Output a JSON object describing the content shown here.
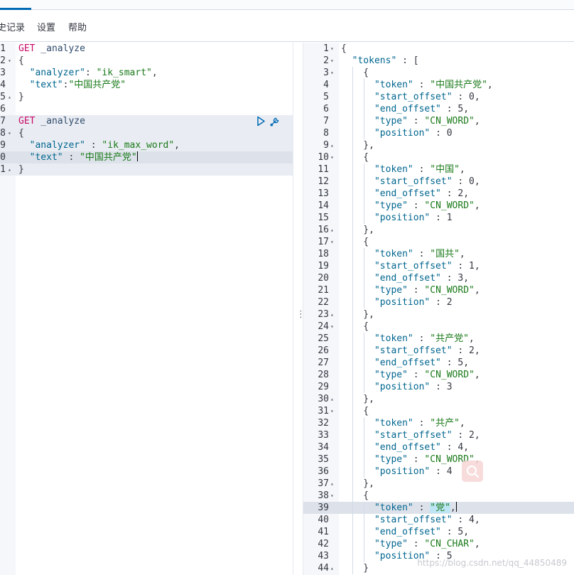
{
  "menu": {
    "history": "史记录",
    "settings": "设置",
    "help": "帮助"
  },
  "request_editor": {
    "lines": [
      {
        "n": "1",
        "fold": "",
        "parts": [
          [
            "method",
            "GET"
          ],
          [
            "url",
            " _analyze"
          ]
        ]
      },
      {
        "n": "2",
        "fold": "▾",
        "parts": [
          [
            "punc",
            "{"
          ]
        ]
      },
      {
        "n": "3",
        "fold": "",
        "parts": [
          [
            "punc",
            "  "
          ],
          [
            "key",
            "\"analyzer\""
          ],
          [
            "punc",
            ": "
          ],
          [
            "str",
            "\"ik_smart\""
          ],
          [
            "punc",
            ","
          ]
        ]
      },
      {
        "n": "4",
        "fold": "",
        "parts": [
          [
            "punc",
            "  "
          ],
          [
            "key",
            "\"text\""
          ],
          [
            "punc",
            ":"
          ],
          [
            "str",
            "\"中国共产党\""
          ]
        ]
      },
      {
        "n": "5",
        "fold": "▴",
        "parts": [
          [
            "punc",
            "}"
          ]
        ]
      },
      {
        "n": "6",
        "fold": "",
        "parts": []
      },
      {
        "n": "7",
        "fold": "",
        "parts": [
          [
            "method",
            "GET"
          ],
          [
            "url",
            " _analyze"
          ]
        ]
      },
      {
        "n": "8",
        "fold": "▾",
        "parts": [
          [
            "punc",
            "{"
          ]
        ]
      },
      {
        "n": "9",
        "fold": "",
        "parts": [
          [
            "punc",
            "  "
          ],
          [
            "key",
            "\"analyzer\""
          ],
          [
            "punc",
            " : "
          ],
          [
            "str",
            "\"ik_max_word\""
          ],
          [
            "punc",
            ","
          ]
        ]
      },
      {
        "n": "0",
        "fold": "",
        "parts": [
          [
            "punc",
            "  "
          ],
          [
            "key",
            "\"text\""
          ],
          [
            "punc",
            " : "
          ],
          [
            "str",
            "\"中国共产党\""
          ]
        ]
      },
      {
        "n": "1",
        "fold": "▴",
        "parts": [
          [
            "punc",
            "}"
          ]
        ]
      }
    ]
  },
  "response_viewer": {
    "lines": [
      {
        "n": "1",
        "fold": "▾",
        "parts": [
          [
            "punc",
            "{"
          ]
        ]
      },
      {
        "n": "2",
        "fold": "▾",
        "parts": [
          [
            "punc",
            "  "
          ],
          [
            "key",
            "\"tokens\""
          ],
          [
            "punc",
            " : ["
          ]
        ]
      },
      {
        "n": "3",
        "fold": "▾",
        "parts": [
          [
            "punc",
            "    {"
          ]
        ]
      },
      {
        "n": "4",
        "fold": "",
        "parts": [
          [
            "punc",
            "      "
          ],
          [
            "key",
            "\"token\""
          ],
          [
            "punc",
            " : "
          ],
          [
            "str",
            "\"中国共产党\""
          ],
          [
            "punc",
            ","
          ]
        ]
      },
      {
        "n": "5",
        "fold": "",
        "parts": [
          [
            "punc",
            "      "
          ],
          [
            "key",
            "\"start_offset\""
          ],
          [
            "punc",
            " : "
          ],
          [
            "num",
            "0"
          ],
          [
            "punc",
            ","
          ]
        ]
      },
      {
        "n": "6",
        "fold": "",
        "parts": [
          [
            "punc",
            "      "
          ],
          [
            "key",
            "\"end_offset\""
          ],
          [
            "punc",
            " : "
          ],
          [
            "num",
            "5"
          ],
          [
            "punc",
            ","
          ]
        ]
      },
      {
        "n": "7",
        "fold": "",
        "parts": [
          [
            "punc",
            "      "
          ],
          [
            "key",
            "\"type\""
          ],
          [
            "punc",
            " : "
          ],
          [
            "str",
            "\"CN_WORD\""
          ],
          [
            "punc",
            ","
          ]
        ]
      },
      {
        "n": "8",
        "fold": "",
        "parts": [
          [
            "punc",
            "      "
          ],
          [
            "key",
            "\"position\""
          ],
          [
            "punc",
            " : "
          ],
          [
            "num",
            "0"
          ]
        ]
      },
      {
        "n": "9",
        "fold": "▴",
        "parts": [
          [
            "punc",
            "    },"
          ]
        ]
      },
      {
        "n": "10",
        "fold": "▾",
        "parts": [
          [
            "punc",
            "    {"
          ]
        ]
      },
      {
        "n": "11",
        "fold": "",
        "parts": [
          [
            "punc",
            "      "
          ],
          [
            "key",
            "\"token\""
          ],
          [
            "punc",
            " : "
          ],
          [
            "str",
            "\"中国\""
          ],
          [
            "punc",
            ","
          ]
        ]
      },
      {
        "n": "12",
        "fold": "",
        "parts": [
          [
            "punc",
            "      "
          ],
          [
            "key",
            "\"start_offset\""
          ],
          [
            "punc",
            " : "
          ],
          [
            "num",
            "0"
          ],
          [
            "punc",
            ","
          ]
        ]
      },
      {
        "n": "13",
        "fold": "",
        "parts": [
          [
            "punc",
            "      "
          ],
          [
            "key",
            "\"end_offset\""
          ],
          [
            "punc",
            " : "
          ],
          [
            "num",
            "2"
          ],
          [
            "punc",
            ","
          ]
        ]
      },
      {
        "n": "14",
        "fold": "",
        "parts": [
          [
            "punc",
            "      "
          ],
          [
            "key",
            "\"type\""
          ],
          [
            "punc",
            " : "
          ],
          [
            "str",
            "\"CN_WORD\""
          ],
          [
            "punc",
            ","
          ]
        ]
      },
      {
        "n": "15",
        "fold": "",
        "parts": [
          [
            "punc",
            "      "
          ],
          [
            "key",
            "\"position\""
          ],
          [
            "punc",
            " : "
          ],
          [
            "num",
            "1"
          ]
        ]
      },
      {
        "n": "16",
        "fold": "▴",
        "parts": [
          [
            "punc",
            "    },"
          ]
        ]
      },
      {
        "n": "17",
        "fold": "▾",
        "parts": [
          [
            "punc",
            "    {"
          ]
        ]
      },
      {
        "n": "18",
        "fold": "",
        "parts": [
          [
            "punc",
            "      "
          ],
          [
            "key",
            "\"token\""
          ],
          [
            "punc",
            " : "
          ],
          [
            "str",
            "\"国共\""
          ],
          [
            "punc",
            ","
          ]
        ]
      },
      {
        "n": "19",
        "fold": "",
        "parts": [
          [
            "punc",
            "      "
          ],
          [
            "key",
            "\"start_offset\""
          ],
          [
            "punc",
            " : "
          ],
          [
            "num",
            "1"
          ],
          [
            "punc",
            ","
          ]
        ]
      },
      {
        "n": "20",
        "fold": "",
        "parts": [
          [
            "punc",
            "      "
          ],
          [
            "key",
            "\"end_offset\""
          ],
          [
            "punc",
            " : "
          ],
          [
            "num",
            "3"
          ],
          [
            "punc",
            ","
          ]
        ]
      },
      {
        "n": "21",
        "fold": "",
        "parts": [
          [
            "punc",
            "      "
          ],
          [
            "key",
            "\"type\""
          ],
          [
            "punc",
            " : "
          ],
          [
            "str",
            "\"CN_WORD\""
          ],
          [
            "punc",
            ","
          ]
        ]
      },
      {
        "n": "22",
        "fold": "",
        "parts": [
          [
            "punc",
            "      "
          ],
          [
            "key",
            "\"position\""
          ],
          [
            "punc",
            " : "
          ],
          [
            "num",
            "2"
          ]
        ]
      },
      {
        "n": "23",
        "fold": "▴",
        "parts": [
          [
            "punc",
            "    },"
          ]
        ]
      },
      {
        "n": "24",
        "fold": "▾",
        "parts": [
          [
            "punc",
            "    {"
          ]
        ]
      },
      {
        "n": "25",
        "fold": "",
        "parts": [
          [
            "punc",
            "      "
          ],
          [
            "key",
            "\"token\""
          ],
          [
            "punc",
            " : "
          ],
          [
            "str",
            "\"共产党\""
          ],
          [
            "punc",
            ","
          ]
        ]
      },
      {
        "n": "26",
        "fold": "",
        "parts": [
          [
            "punc",
            "      "
          ],
          [
            "key",
            "\"start_offset\""
          ],
          [
            "punc",
            " : "
          ],
          [
            "num",
            "2"
          ],
          [
            "punc",
            ","
          ]
        ]
      },
      {
        "n": "27",
        "fold": "",
        "parts": [
          [
            "punc",
            "      "
          ],
          [
            "key",
            "\"end_offset\""
          ],
          [
            "punc",
            " : "
          ],
          [
            "num",
            "5"
          ],
          [
            "punc",
            ","
          ]
        ]
      },
      {
        "n": "28",
        "fold": "",
        "parts": [
          [
            "punc",
            "      "
          ],
          [
            "key",
            "\"type\""
          ],
          [
            "punc",
            " : "
          ],
          [
            "str",
            "\"CN_WORD\""
          ],
          [
            "punc",
            ","
          ]
        ]
      },
      {
        "n": "29",
        "fold": "",
        "parts": [
          [
            "punc",
            "      "
          ],
          [
            "key",
            "\"position\""
          ],
          [
            "punc",
            " : "
          ],
          [
            "num",
            "3"
          ]
        ]
      },
      {
        "n": "30",
        "fold": "▴",
        "parts": [
          [
            "punc",
            "    },"
          ]
        ]
      },
      {
        "n": "31",
        "fold": "▾",
        "parts": [
          [
            "punc",
            "    {"
          ]
        ]
      },
      {
        "n": "32",
        "fold": "",
        "parts": [
          [
            "punc",
            "      "
          ],
          [
            "key",
            "\"token\""
          ],
          [
            "punc",
            " : "
          ],
          [
            "str",
            "\"共产\""
          ],
          [
            "punc",
            ","
          ]
        ]
      },
      {
        "n": "33",
        "fold": "",
        "parts": [
          [
            "punc",
            "      "
          ],
          [
            "key",
            "\"start_offset\""
          ],
          [
            "punc",
            " : "
          ],
          [
            "num",
            "2"
          ],
          [
            "punc",
            ","
          ]
        ]
      },
      {
        "n": "34",
        "fold": "",
        "parts": [
          [
            "punc",
            "      "
          ],
          [
            "key",
            "\"end_offset\""
          ],
          [
            "punc",
            " : "
          ],
          [
            "num",
            "4"
          ],
          [
            "punc",
            ","
          ]
        ]
      },
      {
        "n": "35",
        "fold": "",
        "parts": [
          [
            "punc",
            "      "
          ],
          [
            "key",
            "\"type\""
          ],
          [
            "punc",
            " : "
          ],
          [
            "str",
            "\"CN_WORD\""
          ],
          [
            "punc",
            ","
          ]
        ]
      },
      {
        "n": "36",
        "fold": "",
        "parts": [
          [
            "punc",
            "      "
          ],
          [
            "key",
            "\"position\""
          ],
          [
            "punc",
            " : "
          ],
          [
            "num",
            "4"
          ]
        ]
      },
      {
        "n": "37",
        "fold": "▴",
        "parts": [
          [
            "punc",
            "    },"
          ]
        ]
      },
      {
        "n": "38",
        "fold": "▾",
        "parts": [
          [
            "punc",
            "    {"
          ]
        ]
      },
      {
        "n": "39",
        "fold": "",
        "parts": [
          [
            "punc",
            "      "
          ],
          [
            "key",
            "\"token\""
          ],
          [
            "punc",
            " : "
          ],
          [
            "hl",
            "\"党\""
          ],
          [
            "punc",
            ","
          ]
        ]
      },
      {
        "n": "40",
        "fold": "",
        "parts": [
          [
            "punc",
            "      "
          ],
          [
            "key",
            "\"start_offset\""
          ],
          [
            "punc",
            " : "
          ],
          [
            "num",
            "4"
          ],
          [
            "punc",
            ","
          ]
        ]
      },
      {
        "n": "41",
        "fold": "",
        "parts": [
          [
            "punc",
            "      "
          ],
          [
            "key",
            "\"end_offset\""
          ],
          [
            "punc",
            " : "
          ],
          [
            "num",
            "5"
          ],
          [
            "punc",
            ","
          ]
        ]
      },
      {
        "n": "42",
        "fold": "",
        "parts": [
          [
            "punc",
            "      "
          ],
          [
            "key",
            "\"type\""
          ],
          [
            "punc",
            " : "
          ],
          [
            "str",
            "\"CN_CHAR\""
          ],
          [
            "punc",
            ","
          ]
        ]
      },
      {
        "n": "43",
        "fold": "",
        "parts": [
          [
            "punc",
            "      "
          ],
          [
            "key",
            "\"position\""
          ],
          [
            "punc",
            " : "
          ],
          [
            "num",
            "5"
          ]
        ]
      },
      {
        "n": "44",
        "fold": "▴",
        "parts": [
          [
            "punc",
            "    }"
          ]
        ]
      }
    ]
  },
  "splitter_icon": "⋮",
  "watermark": "https://blog.csdn.net/qq_44850489",
  "icons": {
    "run": "play-icon",
    "settings": "wrench-icon",
    "search": "search-icon"
  },
  "colors": {
    "method": "#c80a68",
    "key": "#00668f",
    "string": "#1a7a1a",
    "accent": "#006bb4"
  }
}
